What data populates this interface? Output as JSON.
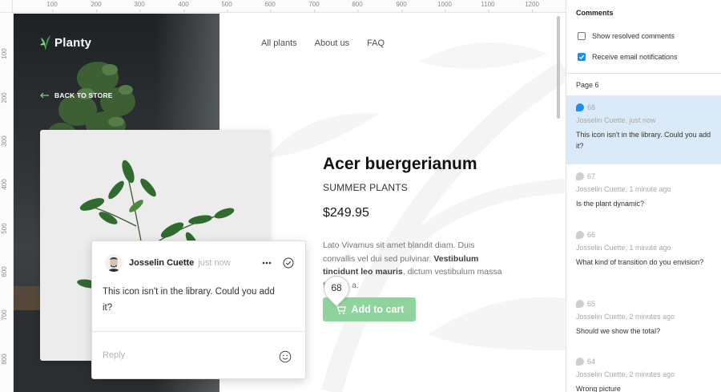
{
  "rulers": {
    "top_labels": [
      "100",
      "200",
      "300",
      "400",
      "500",
      "600",
      "700",
      "800",
      "900",
      "1000",
      "1100",
      "1200"
    ],
    "left_labels": [
      "100",
      "200",
      "300",
      "400",
      "500",
      "600",
      "700",
      "800"
    ]
  },
  "site": {
    "brand": "Planty",
    "back_link": "BACK TO STORE",
    "nav": [
      "All plants",
      "About us",
      "FAQ"
    ]
  },
  "product": {
    "title": "Acer buergerianum",
    "subtitle": "SUMMER PLANTS",
    "price": "$249.95",
    "desc_plain_1": "Lato Vivamus sit amet blandit diam. Duis convallis vel dui sed pulvinar. ",
    "desc_bold": "Vestibulum tincidunt leo mauris",
    "desc_plain_2": ", dictum vestibulum massa fringilla a.",
    "cart_label": "Add to cart"
  },
  "pin": {
    "number": "68"
  },
  "popup": {
    "author": "Josselin Cuette",
    "time": "just now",
    "text": "This icon isn't in the library. Could you add it?",
    "reply_placeholder": "Reply"
  },
  "panel": {
    "title": "Comments",
    "show_resolved": "Show resolved comments",
    "show_resolved_checked": false,
    "email_notifications": "Receive email notifications",
    "email_notifications_checked": true,
    "page_label": "Page 6",
    "comments": [
      {
        "num": "68",
        "meta": "Josselin Cuette, just now",
        "text": "This icon isn't in the library. Could you add it?",
        "active": true
      },
      {
        "num": "67",
        "meta": "Josselin Cuette, 1 minute ago",
        "text": "Is the plant dynamic?",
        "active": false
      },
      {
        "num": "66",
        "meta": "Josselin Cuette, 1 minute ago",
        "text": "What kind of transition do you envision?",
        "active": false
      },
      {
        "num": "65",
        "meta": "Josselin Cuette, 2 minutes ago",
        "text": "Should we show the total?",
        "active": false
      },
      {
        "num": "64",
        "meta": "Josselin Cuette, 2 minutes ago",
        "text": "Wrong picture",
        "active": false
      }
    ]
  },
  "colors": {
    "accent_green": "#8fd49c",
    "active_comment_bg": "#daeaf8",
    "checkbox_blue": "#1a8ef2",
    "hero_dark": "#2f3436"
  }
}
